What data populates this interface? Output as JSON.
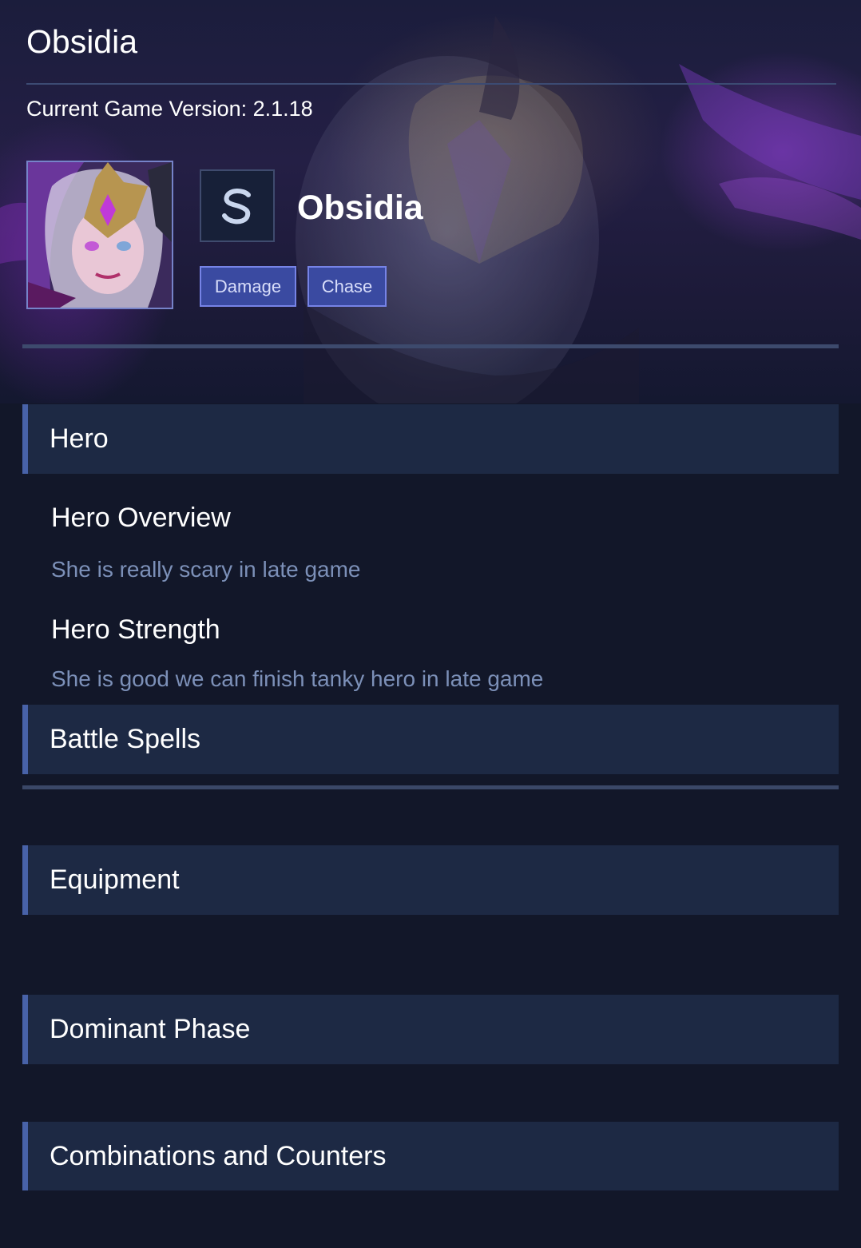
{
  "page": {
    "title": "Obsidia",
    "version_label": "Current Game Version: 2.1.18"
  },
  "hero": {
    "name": "Obsidia",
    "role_icon": "assassin-s-icon",
    "tags": [
      "Damage",
      "Chase"
    ]
  },
  "sections": {
    "hero": {
      "title": "Hero",
      "overview_heading": "Hero Overview",
      "overview_text": "She is really scary in late game",
      "strength_heading": "Hero Strength",
      "strength_text": "She is good we can finish tanky hero in late game"
    },
    "battle_spells": {
      "title": "Battle Spells"
    },
    "equipment": {
      "title": "Equipment"
    },
    "dominant_phase": {
      "title": "Dominant Phase"
    },
    "combinations": {
      "title": "Combinations and Counters"
    }
  },
  "colors": {
    "background": "#121729",
    "section_bar": "#1d2944",
    "section_accent": "#4862a8",
    "tag_fill": "#3a4aa1",
    "tag_border": "#7683e6",
    "muted_text": "#7c90b8"
  }
}
